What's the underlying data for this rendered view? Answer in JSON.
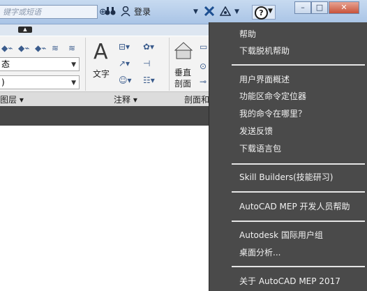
{
  "titlebar": {
    "search_placeholder": "键字或短语",
    "login_label": "登录",
    "window_buttons": [
      "–",
      "□",
      "✕"
    ]
  },
  "quick_access": {
    "pill_label": "▲"
  },
  "ribbon": {
    "layer_state_combo": "态",
    "layer_combo": ")",
    "text_label": "文字",
    "vertical_section_label": "垂直\n剖面",
    "panels": {
      "layers": "图层 ▾",
      "annotation": "注释 ▾",
      "section": "剖面和"
    }
  },
  "help_menu": {
    "items": [
      {
        "label": "帮助"
      },
      {
        "label": "下载脱机帮助"
      },
      {
        "label": "用户界面概述"
      },
      {
        "label": "功能区命令定位器"
      },
      {
        "label": "我的命令在哪里？"
      },
      {
        "label": "发送反馈"
      },
      {
        "label": "下载语言包"
      },
      {
        "label": "Skill Builders(技能研习)"
      },
      {
        "label": "AutoCAD MEP 开发人员帮助"
      },
      {
        "label": "Autodesk 国际用户组"
      },
      {
        "label": "桌面分析..."
      },
      {
        "label": "关于 AutoCAD MEP 2017"
      }
    ]
  },
  "colors": {
    "menu_bg": "#4a4a4a",
    "menu_text": "#f2f2f2",
    "titlebar": "#b9cfeb"
  }
}
